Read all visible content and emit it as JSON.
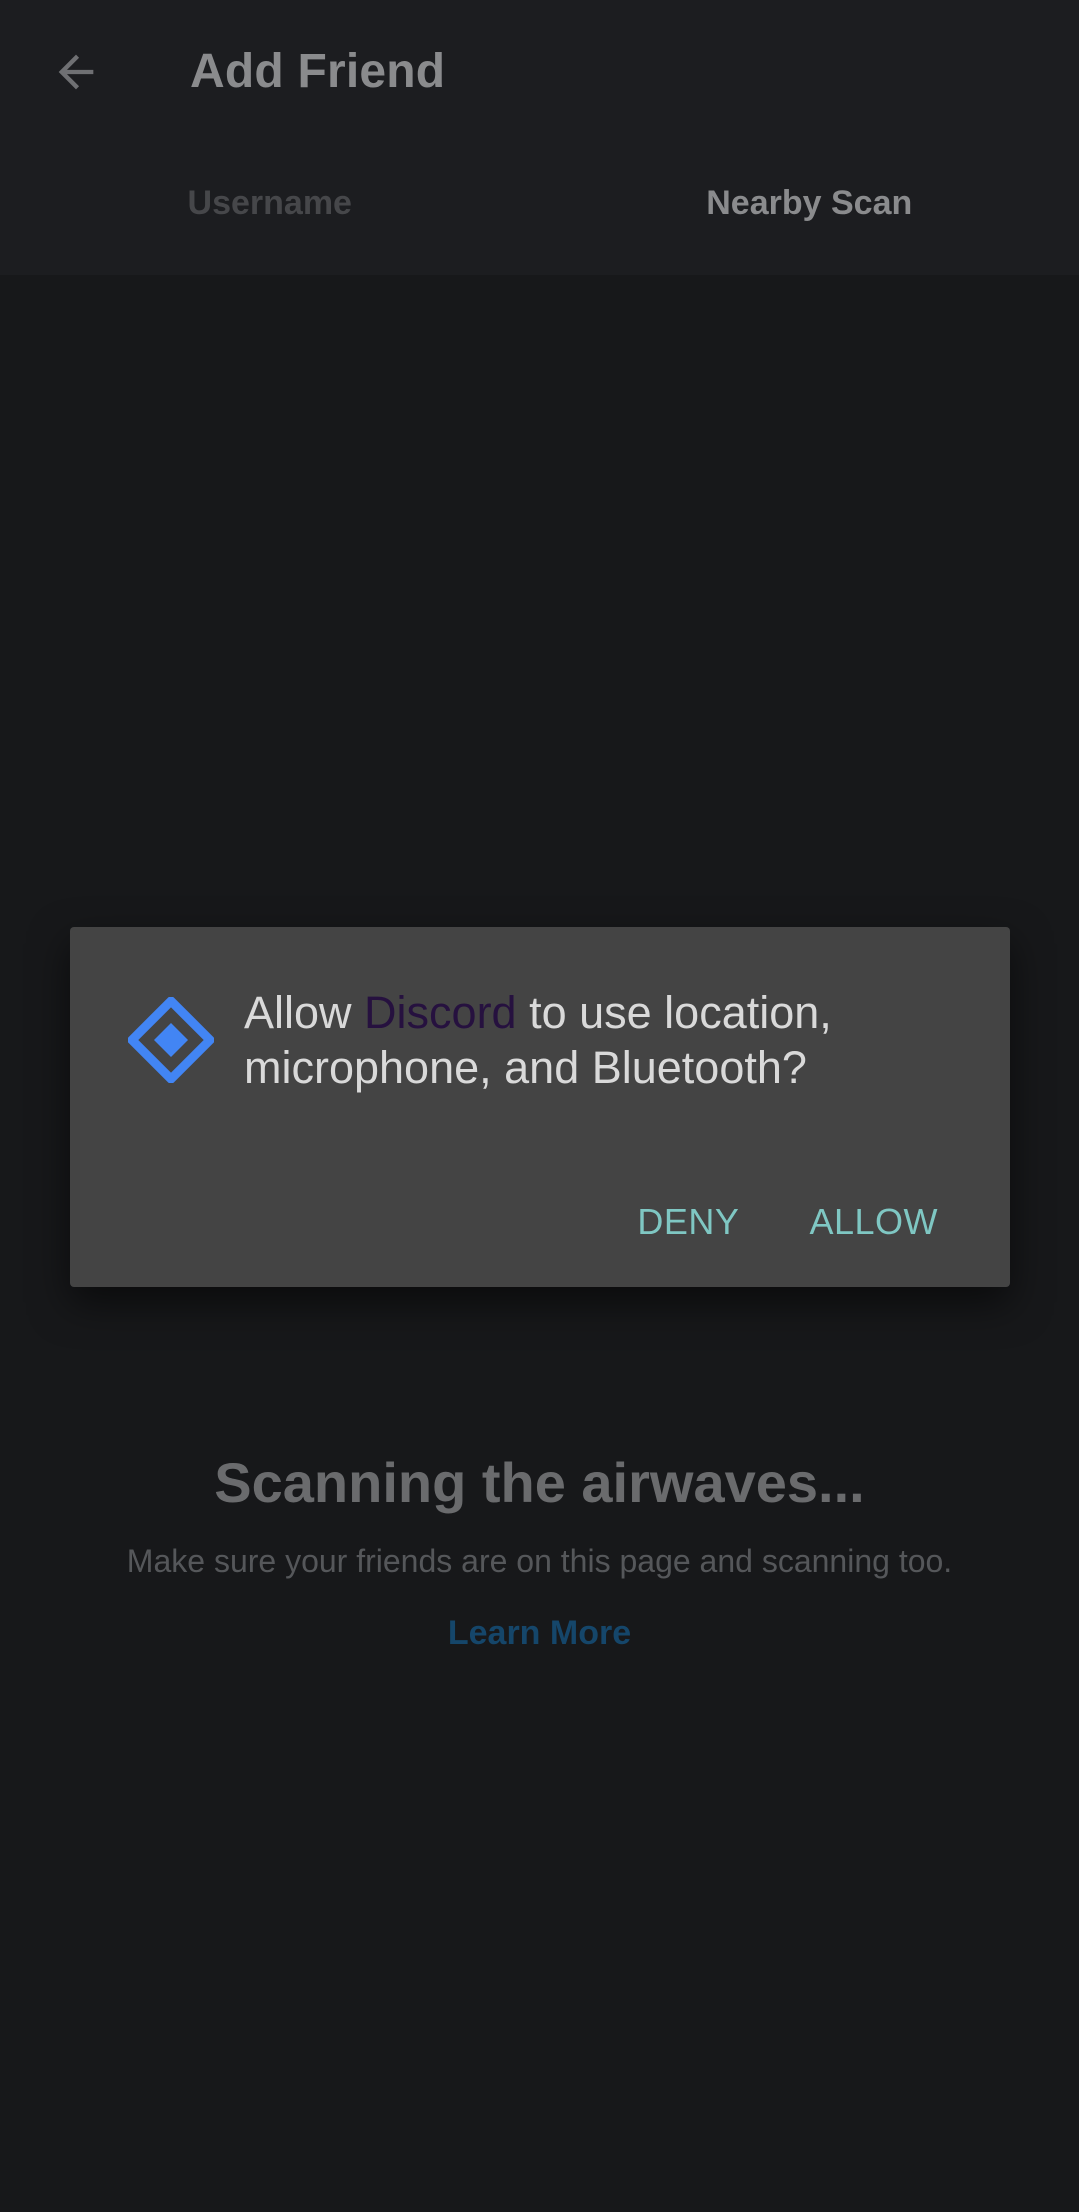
{
  "header": {
    "title": "Add Friend",
    "back_icon": "arrow-left-icon"
  },
  "tabs": [
    {
      "label": "Username",
      "active": false
    },
    {
      "label": "Nearby Scan",
      "active": true
    }
  ],
  "empty_state": {
    "title": "Scanning the airwaves...",
    "subtitle": "Make sure your friends are on this page and scanning too.",
    "link": "Learn More"
  },
  "dialog": {
    "icon": "permission-diamond-icon",
    "message_prefix": "Allow ",
    "app_name": "Discord",
    "message_suffix": " to use location, microphone, and Bluetooth?",
    "deny_label": "DENY",
    "allow_label": "ALLOW"
  },
  "colors": {
    "background": "#17181a",
    "dialog_bg": "#444444",
    "button_accent": "#7fc7c3",
    "icon_blue": "#4285f4",
    "link": "#15466a"
  }
}
